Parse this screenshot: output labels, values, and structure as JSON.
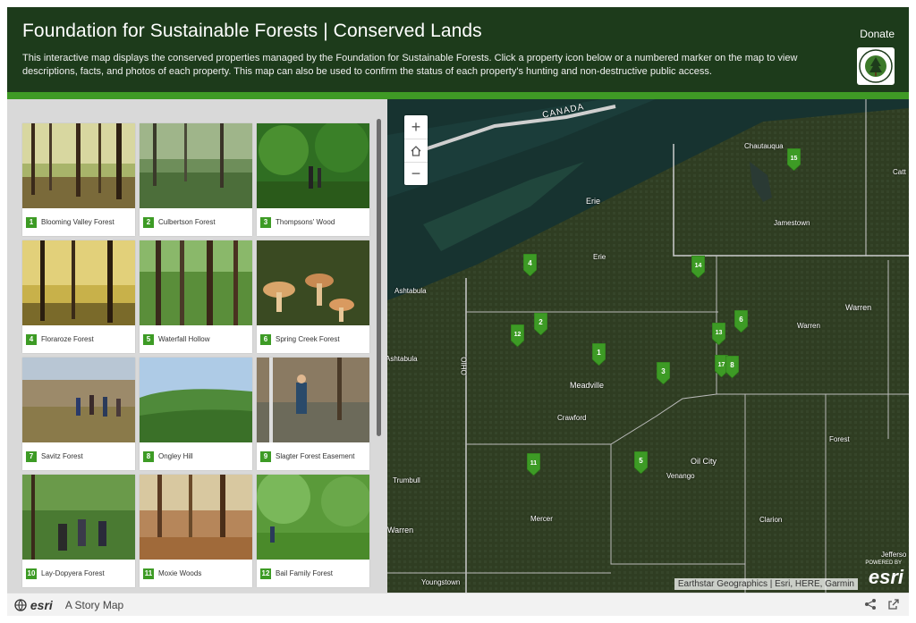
{
  "header": {
    "title": "Foundation for Sustainable Forests | Conserved Lands",
    "description": "This interactive map displays the conserved properties managed by the Foundation for Sustainable Forests. Click a property icon below or a numbered marker on the map to view descriptions, facts, and photos of each property. This map can also be used to confirm the status of each property's hunting and non-destructive public access.",
    "donate_label": "Donate"
  },
  "gallery": {
    "tiles": [
      {
        "num": "1",
        "label": "Blooming Valley Forest"
      },
      {
        "num": "2",
        "label": "Culbertson Forest"
      },
      {
        "num": "3",
        "label": "Thompsons' Wood"
      },
      {
        "num": "4",
        "label": "Floraroze Forest"
      },
      {
        "num": "5",
        "label": "Waterfall Hollow"
      },
      {
        "num": "6",
        "label": "Spring Creek Forest"
      },
      {
        "num": "7",
        "label": "Savitz Forest"
      },
      {
        "num": "8",
        "label": "Ongley Hill"
      },
      {
        "num": "9",
        "label": "Slagter Forest Easement"
      },
      {
        "num": "10",
        "label": "Lay-Dopyera Forest"
      },
      {
        "num": "11",
        "label": "Moxie Woods"
      },
      {
        "num": "12",
        "label": "Bail Family Forest"
      }
    ]
  },
  "map": {
    "zoom_in": "+",
    "zoom_out": "−",
    "labels": {
      "canada": "CANADA",
      "erie_city": "Erie",
      "erie_county": "Erie",
      "chautauqua": "Chautauqua",
      "jamestown": "Jamestown",
      "catt": "Catt",
      "ashtabula_city": "Ashtabula",
      "ashtabula_county": "Ashtabula",
      "ohio": "OHIO",
      "warren_city": "Warren",
      "warren_county": "Warren",
      "meadville": "Meadville",
      "crawford": "Crawford",
      "oil_city": "Oil City",
      "venango": "Venango",
      "forest": "Forest",
      "trumbull": "Trumbull",
      "mercer": "Mercer",
      "warren_oh": "Warren",
      "clarion": "Clarion",
      "youngstown": "Youngstown",
      "jefferson": "Jefferso"
    },
    "markers": [
      "15",
      "4",
      "14",
      "2",
      "12",
      "6",
      "13",
      "1",
      "3",
      "17",
      "8",
      "11",
      "5"
    ],
    "attribution": "Earthstar Geographics | Esri, HERE, Garmin",
    "powered_by": "POWERED BY",
    "esri_logo": "esri"
  },
  "footer": {
    "esri_label": "esri",
    "story_label": "A Story Map"
  },
  "colors": {
    "header_bg": "#1d3b1b",
    "accent_green": "#3f9a25",
    "marker_green": "#3d9b25"
  }
}
